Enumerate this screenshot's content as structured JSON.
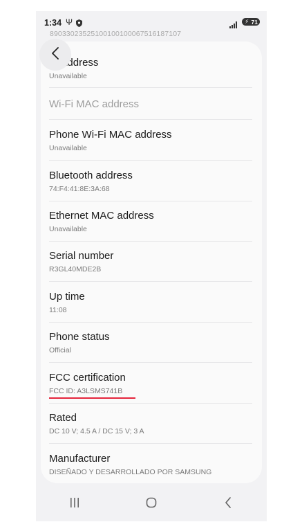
{
  "status": {
    "time": "1:34",
    "battery": "71"
  },
  "iccid": "89033023525100100100067516187107",
  "items": [
    {
      "title": "IP address",
      "subtitle": "Unavailable"
    },
    {
      "title": "Wi-Fi MAC address",
      "subtitle": ""
    },
    {
      "title": "Phone Wi-Fi MAC address",
      "subtitle": "Unavailable"
    },
    {
      "title": "Bluetooth address",
      "subtitle": "74:F4:41:8E:3A:68"
    },
    {
      "title": "Ethernet MAC address",
      "subtitle": "Unavailable"
    },
    {
      "title": "Serial number",
      "subtitle": "R3GL40MDE2B"
    },
    {
      "title": "Up time",
      "subtitle": "11:08"
    },
    {
      "title": "Phone status",
      "subtitle": "Official"
    },
    {
      "title": "FCC certification",
      "subtitle": "FCC ID: A3LSMS741B"
    },
    {
      "title": "Rated",
      "subtitle": "DC 10 V; 4.5 A / DC 15 V; 3 A"
    },
    {
      "title": "Manufacturer",
      "subtitle": "DISEÑADO Y DESARROLLADO POR SAMSUNG"
    }
  ],
  "icons": {
    "back": "chevron-left-icon",
    "recents": "recents-icon",
    "home": "home-icon",
    "nav_back": "back-icon"
  },
  "colors": {
    "highlight": "#e5243b"
  }
}
